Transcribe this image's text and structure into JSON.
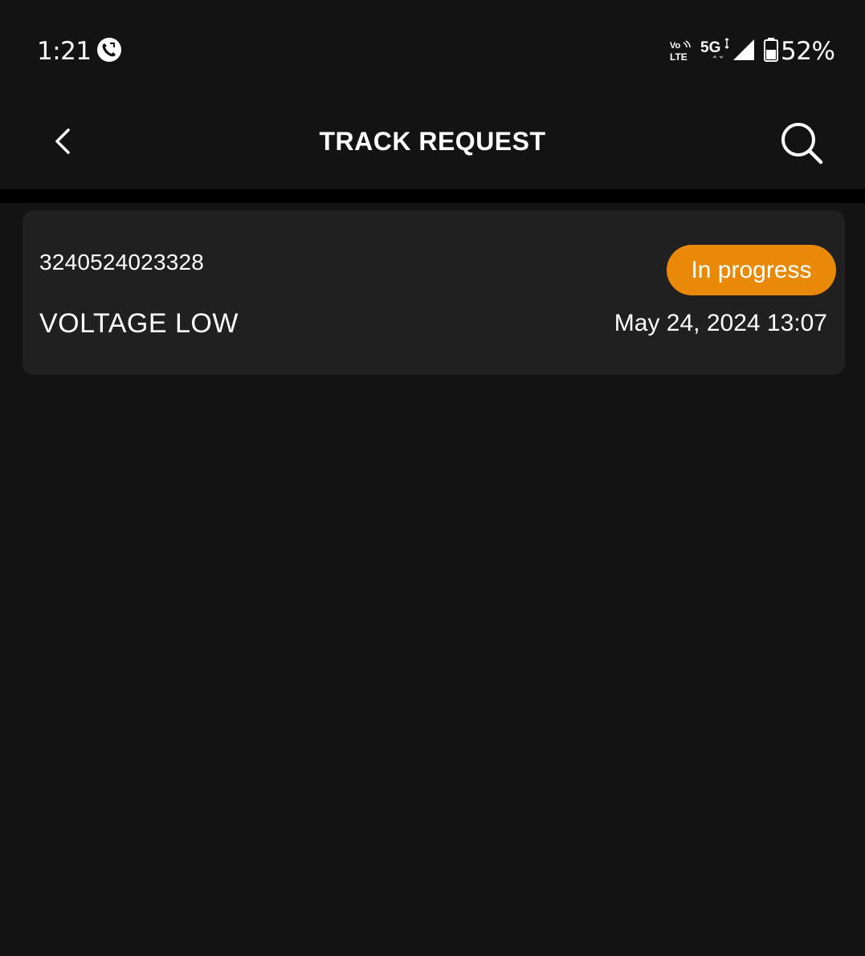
{
  "status_bar": {
    "time": "1:21",
    "network_volte": "VoLTE",
    "network_type": "5G",
    "battery_percent": "52%"
  },
  "header": {
    "title": "TRACK REQUEST",
    "back_icon": "chevron-left-icon",
    "search_icon": "search-icon"
  },
  "requests": [
    {
      "id": "3240524023328",
      "title": "VOLTAGE LOW",
      "status": "In progress",
      "date": "May 24, 2024 13:07"
    }
  ],
  "colors": {
    "background": "#131313",
    "card": "#202020",
    "status_in_progress": "#e88a07",
    "divider": "#000000"
  }
}
